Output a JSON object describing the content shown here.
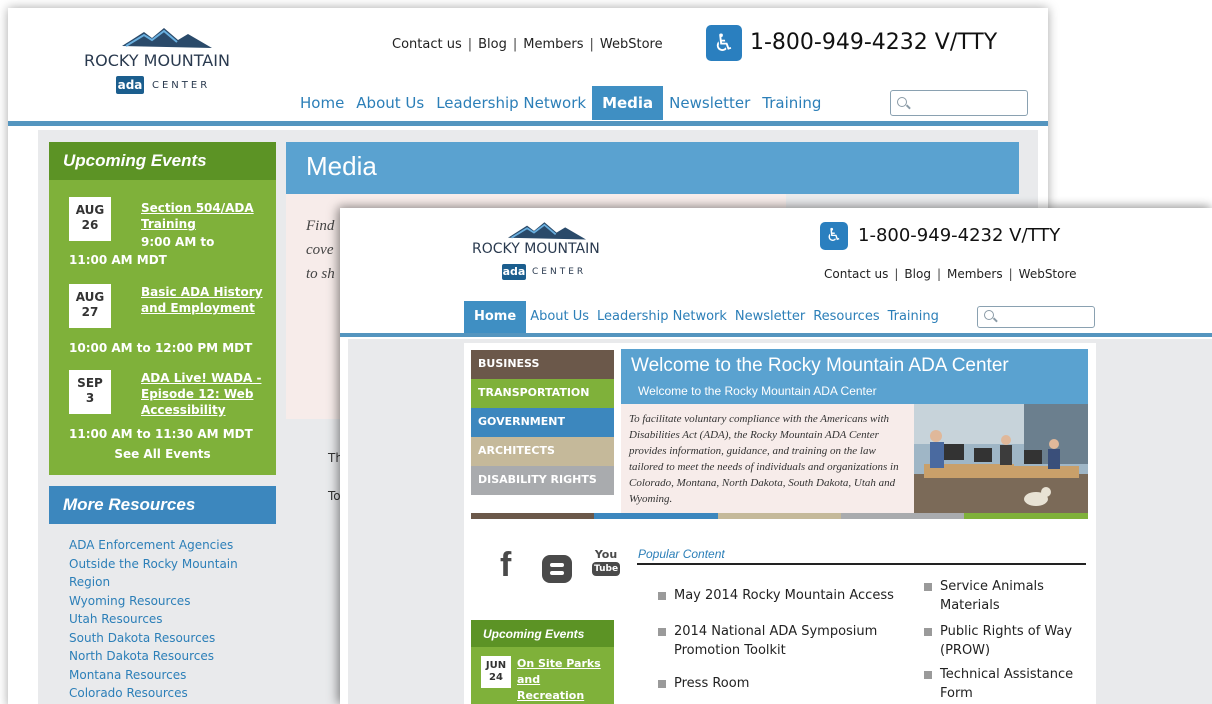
{
  "colors": {
    "nav_blue": "#2c7fb8",
    "banner_blue": "#5aa2d0",
    "event_green": "#7fb13a",
    "event_green_dark": "#5c9325",
    "intro_pink": "#f7ecea",
    "bar_blue": "#5495bf"
  },
  "back": {
    "logo": {
      "name": "ROCKY MOUNTAIN",
      "mark": "ada",
      "center": "CENTER"
    },
    "top_links": [
      "Contact us",
      "Blog",
      "Members",
      "WebStore"
    ],
    "phone": "1-800-949-4232  V/TTY",
    "accessibility_icon": "wheelchair-icon",
    "nav": [
      "Home",
      "About Us",
      "Leadership Network",
      "Media",
      "Newsletter",
      "Training"
    ],
    "nav_active": "Media",
    "events": {
      "heading": "Upcoming Events",
      "items": [
        {
          "month": "AUG",
          "day": "26",
          "title": "Section 504/ADA Training",
          "time_inline": "9:00 AM to",
          "time_line": "11:00 AM MDT"
        },
        {
          "month": "AUG",
          "day": "27",
          "title": "Basic ADA History and Employment",
          "time_line": "10:00 AM to 12:00 PM MDT"
        },
        {
          "month": "SEP",
          "day": "3",
          "title": "ADA Live! WADA - Episode 12: Web Accessibility",
          "time_line": "11:00 AM to 11:30 AM MDT"
        }
      ],
      "see_all": "See All Events"
    },
    "resources": {
      "heading": "More Resources",
      "items": [
        "ADA Enforcement Agencies",
        "Outside the Rocky Mountain",
        "Region",
        "Wyoming Resources",
        "Utah Resources",
        "South Dakota Resources",
        "North Dakota Resources",
        "Montana Resources",
        "Colorado Resources"
      ]
    },
    "media_title": "Media",
    "intro_lines": [
      "Find",
      "cove",
      "to sh"
    ],
    "frag_1": "Th",
    "frag_2": "To"
  },
  "front": {
    "logo": {
      "name": "ROCKY MOUNTAIN",
      "mark": "ada",
      "center": "CENTER"
    },
    "phone": "1-800-949-4232  V/TTY",
    "accessibility_icon": "wheelchair-icon",
    "top_links": [
      "Contact us",
      "Blog",
      "Members",
      "WebStore"
    ],
    "nav": [
      "Home",
      "About Us",
      "Leadership Network",
      "Newsletter",
      "Resources",
      "Training"
    ],
    "nav_active": "Home",
    "categories": [
      {
        "label": "BUSINESS",
        "color": "#6b584a"
      },
      {
        "label": "TRANSPORTATION",
        "color": "#7fb13a"
      },
      {
        "label": "GOVERNMENT",
        "color": "#3c87be"
      },
      {
        "label": "ARCHITECTS",
        "color": "#c5b99a"
      },
      {
        "label": "DISABILITY RIGHTS",
        "color": "#a9abae"
      }
    ],
    "welcome_title": "Welcome to the Rocky Mountain ADA Center",
    "welcome_subtitle": "Welcome to the Rocky Mountain ADA Center",
    "welcome_body": "To facilitate voluntary compliance with the Americans with Disabilities Act (ADA), the Rocky Mountain ADA Center provides information, guidance, and training on the law tailored to meet the needs of individuals and organizations in Colorado, Montana, North Dakota, South Dakota, Utah and Wyoming.",
    "social": {
      "facebook": "f",
      "youtube_top": "You",
      "youtube_bottom": "Tube"
    },
    "popular_heading": "Popular Content",
    "popular_left": [
      "May 2014 Rocky Mountain Access",
      "2014 National ADA Symposium Promotion Toolkit",
      "Press Room"
    ],
    "popular_right": [
      "Service Animals Materials",
      "Public Rights of Way (PROW)",
      "Technical Assistance Form"
    ],
    "events": {
      "heading": "Upcoming Events",
      "month": "JUN",
      "day": "24",
      "title": "On Site Parks and Recreation Training"
    }
  }
}
